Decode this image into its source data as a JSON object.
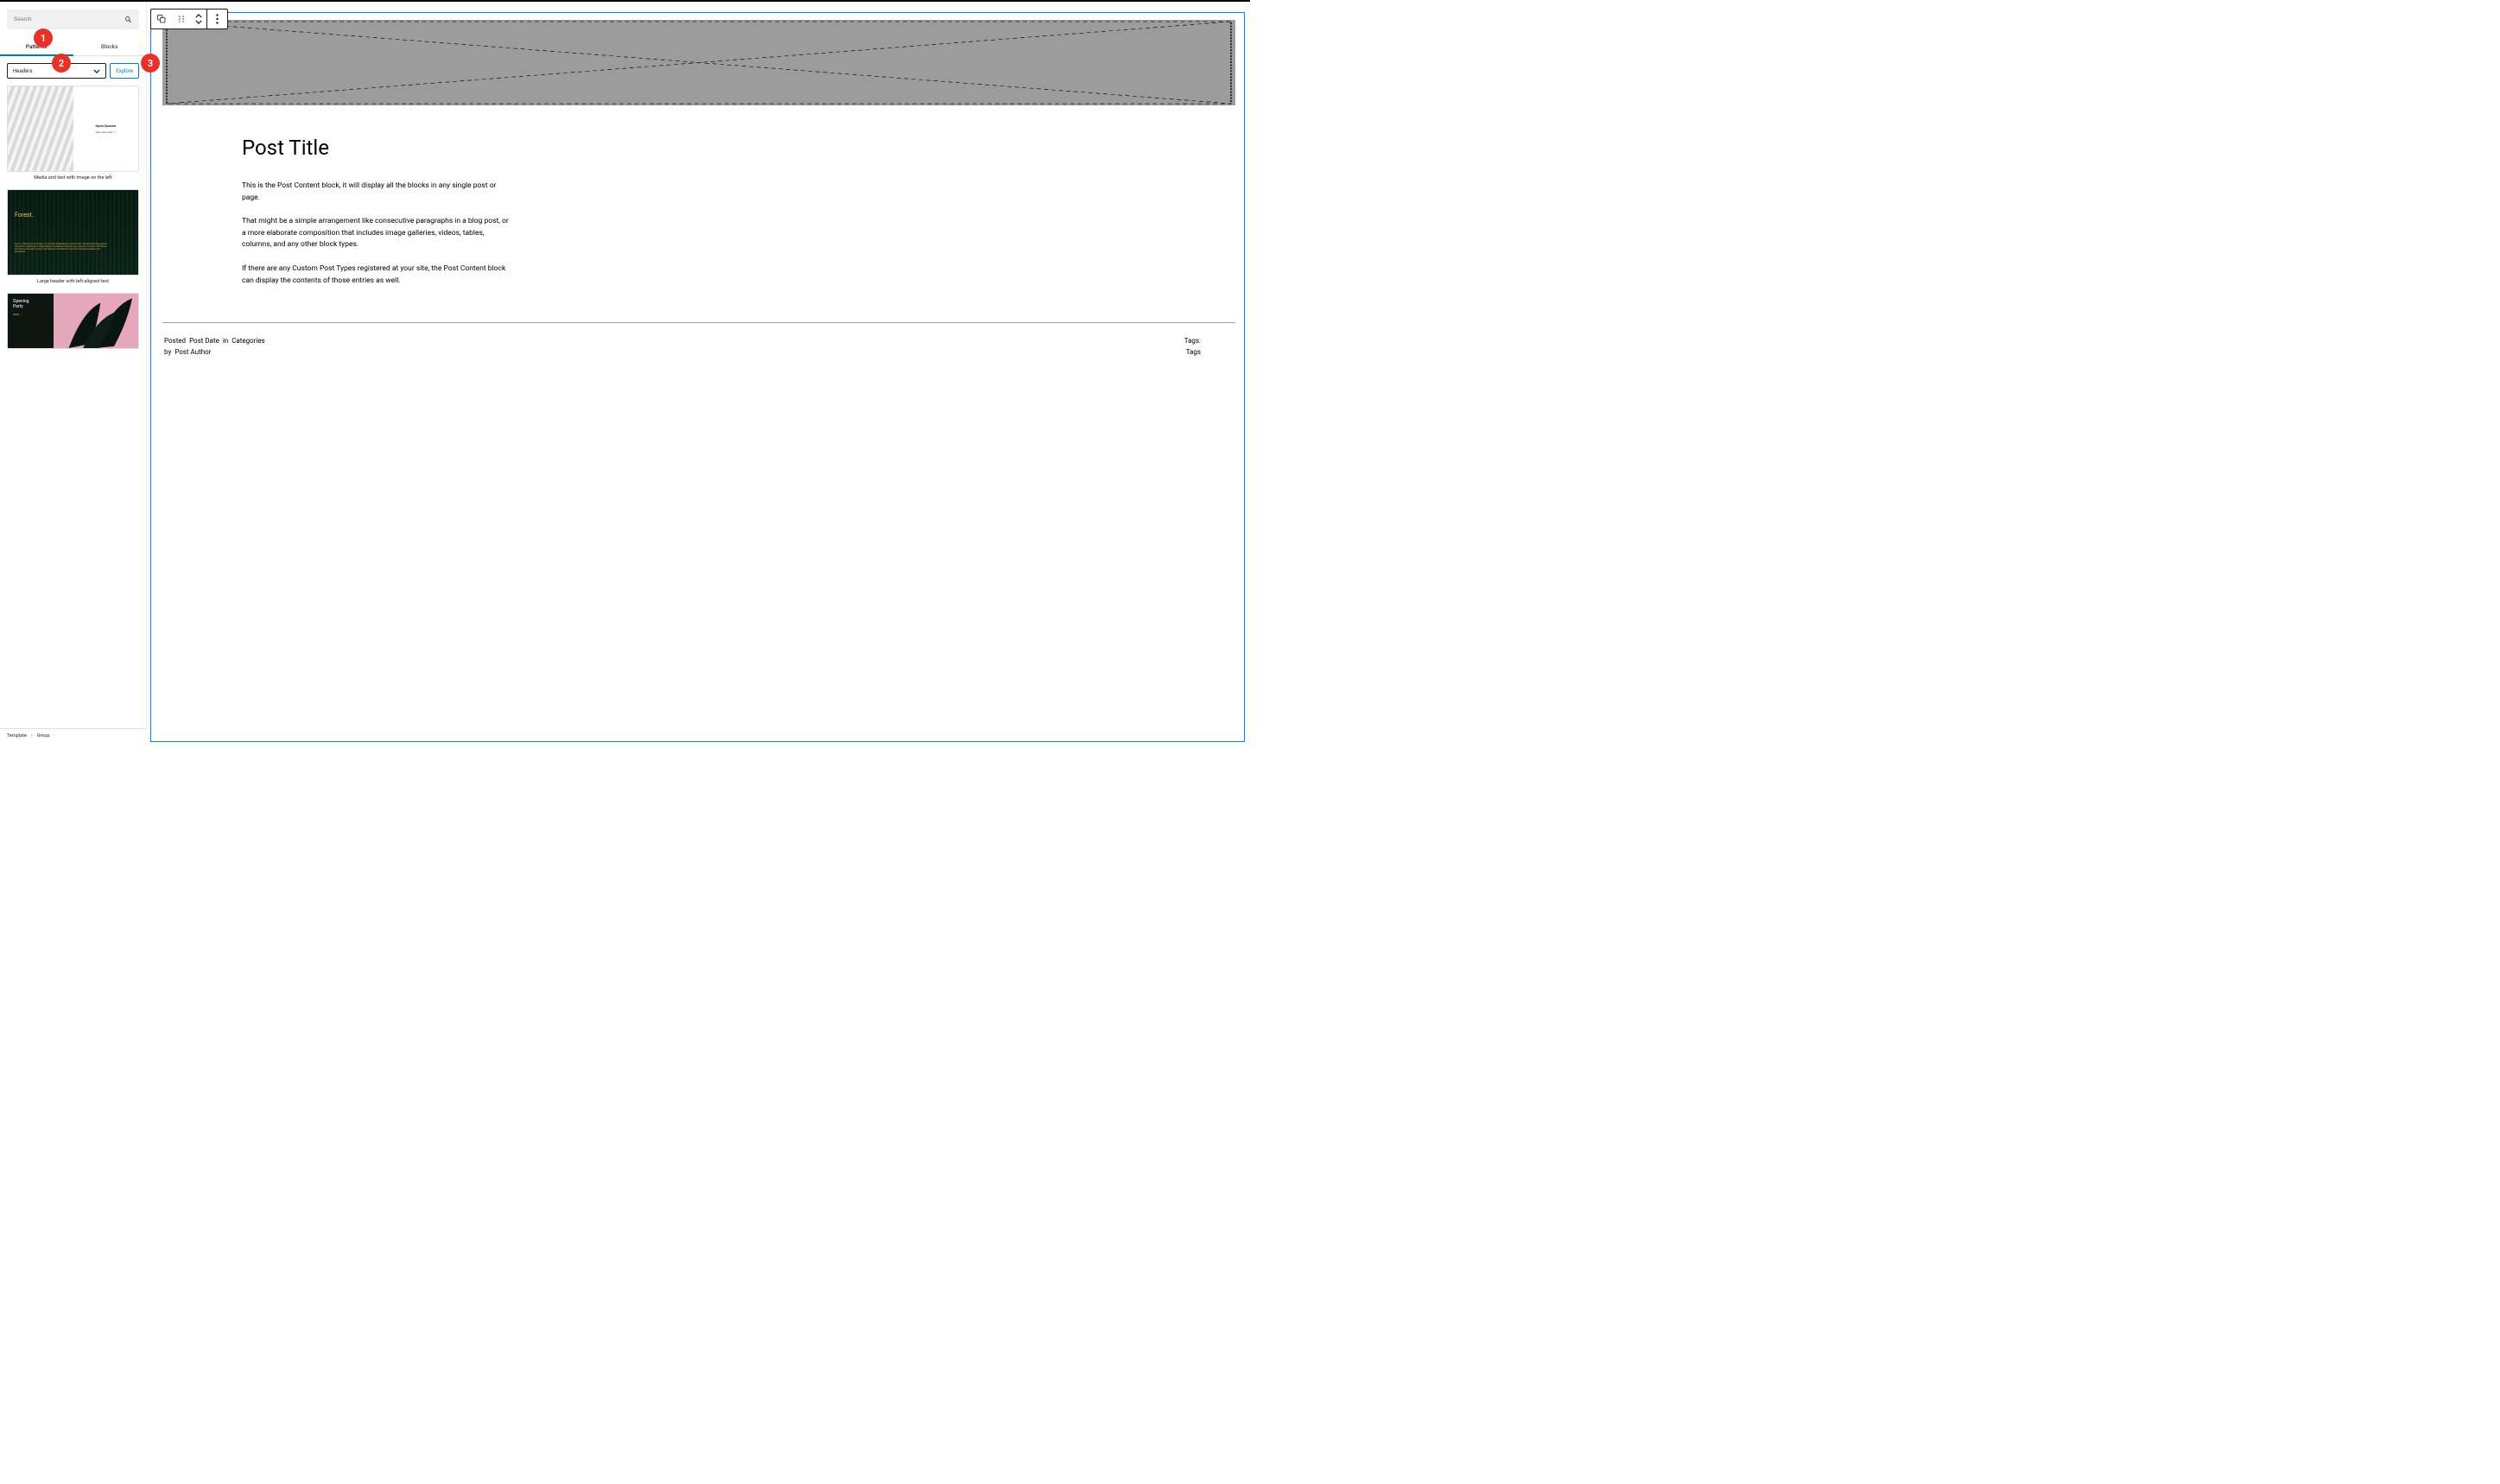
{
  "badges": [
    "1",
    "2",
    "3"
  ],
  "sidebar": {
    "search": {
      "placeholder": "Search"
    },
    "tabs": {
      "patterns": "Patterns",
      "blocks": "Blocks"
    },
    "dropdown": {
      "value": "Headers"
    },
    "explore": "Explore",
    "patterns": [
      {
        "preview": {
          "title": "Open Spaces",
          "subtitle": "See case study ↗"
        },
        "caption": "Media and text with image on the left"
      },
      {
        "preview": {
          "title": "Forest.",
          "desc": "From a child's eyes the forest is. The fresh, breathtaking smell of trees. Echoes birds flying above that dense magnitude. A shade shelter, a sustained wildness and a source of culture. Yet forests and other ecosystems hang in the balance, threatened to become croplands, pasture, and plantations."
        },
        "caption": "Large header with left-aligned text"
      },
      {
        "preview": {
          "title1": "Opening",
          "title2": "Party",
          "rsvp": "RSVP →"
        },
        "caption": ""
      }
    ]
  },
  "breadcrumb": {
    "root": "Template",
    "child": "Group"
  },
  "toolbar": {},
  "post": {
    "title": "Post Title",
    "para1": "This is the Post Content block, it will display all the blocks in any single post or page.",
    "para2": "That might be a simple arrangement like consecutive paragraphs in a blog post, or a more elaborate composition that includes image galleries, videos, tables, columns, and any other block types.",
    "para3": "If there are any Custom Post Types registered at your site, the Post Content block can display the contents of those entries as well."
  },
  "meta": {
    "posted": "Posted",
    "post_date": "Post Date",
    "in": "in",
    "categories": "Categories",
    "by": "by",
    "post_author": "Post Author",
    "tags_label": "Tags:",
    "tags_label2": "Tags"
  }
}
